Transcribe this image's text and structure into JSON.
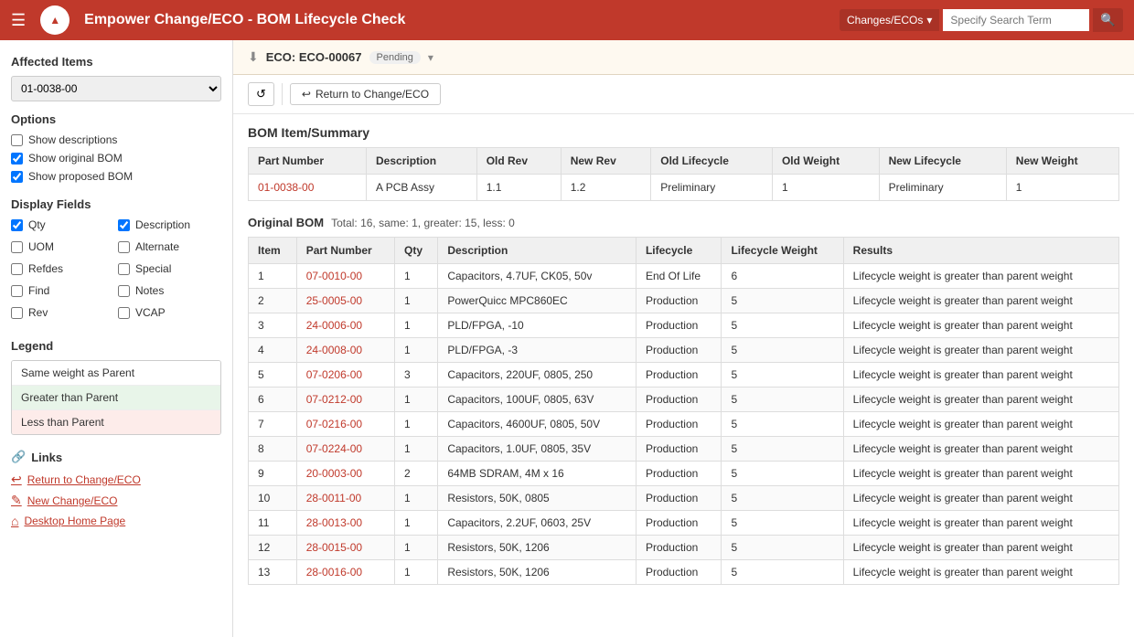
{
  "header": {
    "logo_text": "▲",
    "title": "Empower Change/ECO - BOM Lifecycle Check",
    "search_dropdown_label": "Changes/ECOs",
    "search_placeholder": "Specify Search Term",
    "search_icon": "🔍",
    "hamburger": "☰"
  },
  "sidebar": {
    "affected_items_title": "Affected Items",
    "affected_items_value": "01-0038-00",
    "options_title": "Options",
    "options": [
      {
        "label": "Show descriptions",
        "checked": false
      },
      {
        "label": "Show original BOM",
        "checked": true
      },
      {
        "label": "Show proposed BOM",
        "checked": true
      }
    ],
    "display_fields_title": "Display Fields",
    "display_fields": [
      {
        "label": "Qty",
        "checked": true
      },
      {
        "label": "Description",
        "checked": true
      },
      {
        "label": "UOM",
        "checked": false
      },
      {
        "label": "Alternate",
        "checked": false
      },
      {
        "label": "Refdes",
        "checked": false
      },
      {
        "label": "Special",
        "checked": false
      },
      {
        "label": "Find",
        "checked": false
      },
      {
        "label": "Notes",
        "checked": false
      },
      {
        "label": "Rev",
        "checked": false
      },
      {
        "label": "VCAP",
        "checked": false
      }
    ],
    "legend_title": "Legend",
    "legend_items": [
      {
        "label": "Same weight as Parent",
        "style": "same"
      },
      {
        "label": "Greater than Parent",
        "style": "greater"
      },
      {
        "label": "Less than Parent",
        "style": "less"
      }
    ],
    "links_title": "Links",
    "links": [
      {
        "label": "Return to Change/ECO",
        "icon": "↩"
      },
      {
        "label": "New Change/ECO",
        "icon": "✎"
      },
      {
        "label": "Desktop Home Page",
        "icon": "⌂"
      }
    ]
  },
  "eco_bar": {
    "icon": "⬇",
    "label": "ECO: ECO-00067",
    "badge": "Pending",
    "chevron": "▾"
  },
  "action_bar": {
    "refresh_icon": "↺",
    "return_label": "Return to Change/ECO",
    "return_icon": "↩"
  },
  "bom_summary": {
    "section_title": "BOM Item/Summary",
    "columns": [
      "Part Number",
      "Description",
      "Old Rev",
      "New Rev",
      "Old Lifecycle",
      "Old Weight",
      "New Lifecycle",
      "New Weight"
    ],
    "rows": [
      {
        "part_number": "01-0038-00",
        "description": "A PCB Assy",
        "old_rev": "1.1",
        "new_rev": "1.2",
        "old_lifecycle": "Preliminary",
        "old_weight": "1",
        "new_lifecycle": "Preliminary",
        "new_weight": "1"
      }
    ]
  },
  "original_bom": {
    "title": "Original BOM",
    "stats": "Total: 16, same: 1, greater: 15, less: 0",
    "columns": [
      "Item",
      "Part Number",
      "Qty",
      "Description",
      "Lifecycle",
      "Lifecycle Weight",
      "Results"
    ],
    "rows": [
      {
        "item": "1",
        "part_number": "07-0010-00",
        "qty": "1",
        "description": "Capacitors, 4.7UF, CK05, 50v",
        "lifecycle": "End Of Life",
        "lifecycle_weight": "6",
        "result": "Lifecycle weight is greater than parent weight"
      },
      {
        "item": "2",
        "part_number": "25-0005-00",
        "qty": "1",
        "description": "PowerQuicc MPC860EC",
        "lifecycle": "Production",
        "lifecycle_weight": "5",
        "result": "Lifecycle weight is greater than parent weight"
      },
      {
        "item": "3",
        "part_number": "24-0006-00",
        "qty": "1",
        "description": "PLD/FPGA, -10",
        "lifecycle": "Production",
        "lifecycle_weight": "5",
        "result": "Lifecycle weight is greater than parent weight"
      },
      {
        "item": "4",
        "part_number": "24-0008-00",
        "qty": "1",
        "description": "PLD/FPGA, -3",
        "lifecycle": "Production",
        "lifecycle_weight": "5",
        "result": "Lifecycle weight is greater than parent weight"
      },
      {
        "item": "5",
        "part_number": "07-0206-00",
        "qty": "3",
        "description": "Capacitors, 220UF, 0805, 250",
        "lifecycle": "Production",
        "lifecycle_weight": "5",
        "result": "Lifecycle weight is greater than parent weight"
      },
      {
        "item": "6",
        "part_number": "07-0212-00",
        "qty": "1",
        "description": "Capacitors, 100UF, 0805, 63V",
        "lifecycle": "Production",
        "lifecycle_weight": "5",
        "result": "Lifecycle weight is greater than parent weight"
      },
      {
        "item": "7",
        "part_number": "07-0216-00",
        "qty": "1",
        "description": "Capacitors, 4600UF, 0805, 50V",
        "lifecycle": "Production",
        "lifecycle_weight": "5",
        "result": "Lifecycle weight is greater than parent weight"
      },
      {
        "item": "8",
        "part_number": "07-0224-00",
        "qty": "1",
        "description": "Capacitors, 1.0UF, 0805, 35V",
        "lifecycle": "Production",
        "lifecycle_weight": "5",
        "result": "Lifecycle weight is greater than parent weight"
      },
      {
        "item": "9",
        "part_number": "20-0003-00",
        "qty": "2",
        "description": "64MB SDRAM, 4M x 16",
        "lifecycle": "Production",
        "lifecycle_weight": "5",
        "result": "Lifecycle weight is greater than parent weight"
      },
      {
        "item": "10",
        "part_number": "28-0011-00",
        "qty": "1",
        "description": "Resistors, 50K, 0805",
        "lifecycle": "Production",
        "lifecycle_weight": "5",
        "result": "Lifecycle weight is greater than parent weight"
      },
      {
        "item": "11",
        "part_number": "28-0013-00",
        "qty": "1",
        "description": "Capacitors, 2.2UF, 0603, 25V",
        "lifecycle": "Production",
        "lifecycle_weight": "5",
        "result": "Lifecycle weight is greater than parent weight"
      },
      {
        "item": "12",
        "part_number": "28-0015-00",
        "qty": "1",
        "description": "Resistors, 50K, 1206",
        "lifecycle": "Production",
        "lifecycle_weight": "5",
        "result": "Lifecycle weight is greater than parent weight"
      },
      {
        "item": "13",
        "part_number": "28-0016-00",
        "qty": "1",
        "description": "Resistors, 50K, 1206",
        "lifecycle": "Production",
        "lifecycle_weight": "5",
        "result": "Lifecycle weight is greater than parent weight"
      }
    ]
  }
}
